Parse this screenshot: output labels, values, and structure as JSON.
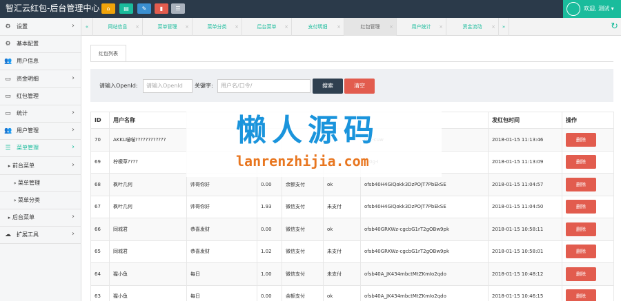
{
  "app": {
    "title": "智汇云红包-后台管理中心"
  },
  "toolbar": {
    "buttons": [
      {
        "icon": "home-icon",
        "color": "#f0a30a"
      },
      {
        "icon": "layout-icon",
        "color": "#1abc9c"
      },
      {
        "icon": "edit-icon",
        "color": "#3a8fd0"
      },
      {
        "icon": "trash-icon",
        "color": "#e25c4e"
      },
      {
        "icon": "list-icon",
        "color": "#aab2bd"
      }
    ]
  },
  "user": {
    "greeting": "欢迎, 测试 ▾"
  },
  "sidebar": {
    "items": [
      {
        "label": "设置",
        "icon": "gears-icon",
        "chevron": "›"
      },
      {
        "label": "基本配置",
        "icon": "gears-icon",
        "chevron": ""
      },
      {
        "label": "用户信息",
        "icon": "users-icon",
        "chevron": ""
      },
      {
        "label": "资金明细",
        "icon": "monitor-icon",
        "chevron": "›"
      },
      {
        "label": "红包管理",
        "icon": "monitor-icon",
        "chevron": ""
      },
      {
        "label": "统计",
        "icon": "monitor-icon",
        "chevron": "›"
      },
      {
        "label": "用户管理",
        "icon": "users-icon",
        "chevron": "›"
      },
      {
        "label": "菜单管理",
        "icon": "list-icon",
        "chevron": "›"
      },
      {
        "label": "前台菜单",
        "icon": "caret-right-icon",
        "chevron": "›"
      },
      {
        "label": "菜单管理",
        "icon": "caret-right-icon",
        "chevron": ""
      },
      {
        "label": "菜单分类",
        "icon": "caret-right-icon",
        "chevron": ""
      },
      {
        "label": "后台菜单",
        "icon": "caret-right-icon",
        "chevron": "›"
      },
      {
        "label": "扩展工具",
        "icon": "cloud-icon",
        "chevron": "›"
      }
    ]
  },
  "tabs": [
    {
      "label": "«"
    },
    {
      "label": "网站信息"
    },
    {
      "label": "菜单管理"
    },
    {
      "label": "菜单分类"
    },
    {
      "label": "后台菜单"
    },
    {
      "label": "支付明细"
    },
    {
      "label": "红包管理"
    },
    {
      "label": "用户统计"
    },
    {
      "label": "资金流动"
    },
    {
      "label": "»"
    }
  ],
  "tab_close": "×",
  "refresh_icon": "↻",
  "panel": {
    "tab_label": "红包列表"
  },
  "search": {
    "openid_label": "请输入OpenId:",
    "openid_placeholder": "请输入OpenId",
    "keyword_label": "关键字:",
    "keyword_placeholder": "用户名/口令/",
    "search_btn": "搜索",
    "clear_btn": "清空"
  },
  "table": {
    "headers": [
      "ID",
      "用户名称",
      "",
      "",
      "",
      "",
      "",
      "发红包时间",
      "操作"
    ],
    "delete_label": "删除",
    "rows": [
      [
        "70",
        "AKKL喵喵????????????",
        "",
        "",
        "",
        "",
        "o…-cuw",
        "2018-01-15 11:13:46"
      ],
      [
        "69",
        "柠檬草????",
        "",
        "",
        "",
        "",
        "…0g-I",
        "2018-01-15 11:13:09"
      ],
      [
        "68",
        "枫叶几何",
        "帅哥你好",
        "0.00",
        "余额支付",
        "ok",
        "ofsb40H4GiQokk3DzPOjT7PbEkSE",
        "2018-01-15 11:04:57"
      ],
      [
        "67",
        "枫叶几何",
        "帅哥你好",
        "1.93",
        "微信支付",
        "未支付",
        "ofsb40H4GiQokk3DzPOjT7PbEkSE",
        "2018-01-15 11:04:50"
      ],
      [
        "66",
        "同城君",
        "恭喜发财",
        "0.00",
        "微信支付",
        "ok",
        "ofsb40GRKWz-cgcbG1rT2gOBw9pk",
        "2018-01-15 10:58:11"
      ],
      [
        "65",
        "同城君",
        "恭喜发财",
        "1.02",
        "微信支付",
        "未支付",
        "ofsb40GRKWz-cgcbG1rT2gOBw9pk",
        "2018-01-15 10:58:01"
      ],
      [
        "64",
        "猩小鱼",
        "每日",
        "1.00",
        "微信支付",
        "未支付",
        "ofsb40A_JK434mbctMtZKmIo2qdo",
        "2018-01-15 10:48:12"
      ],
      [
        "63",
        "猩小鱼",
        "每日",
        "0.00",
        "余额支付",
        "ok",
        "ofsb40A_JK434mbctMtZKmIo2qdo",
        "2018-01-15 10:46:15"
      ]
    ]
  },
  "watermark": {
    "cn": "懒人源码",
    "en": "lanrenzhijia.com"
  }
}
